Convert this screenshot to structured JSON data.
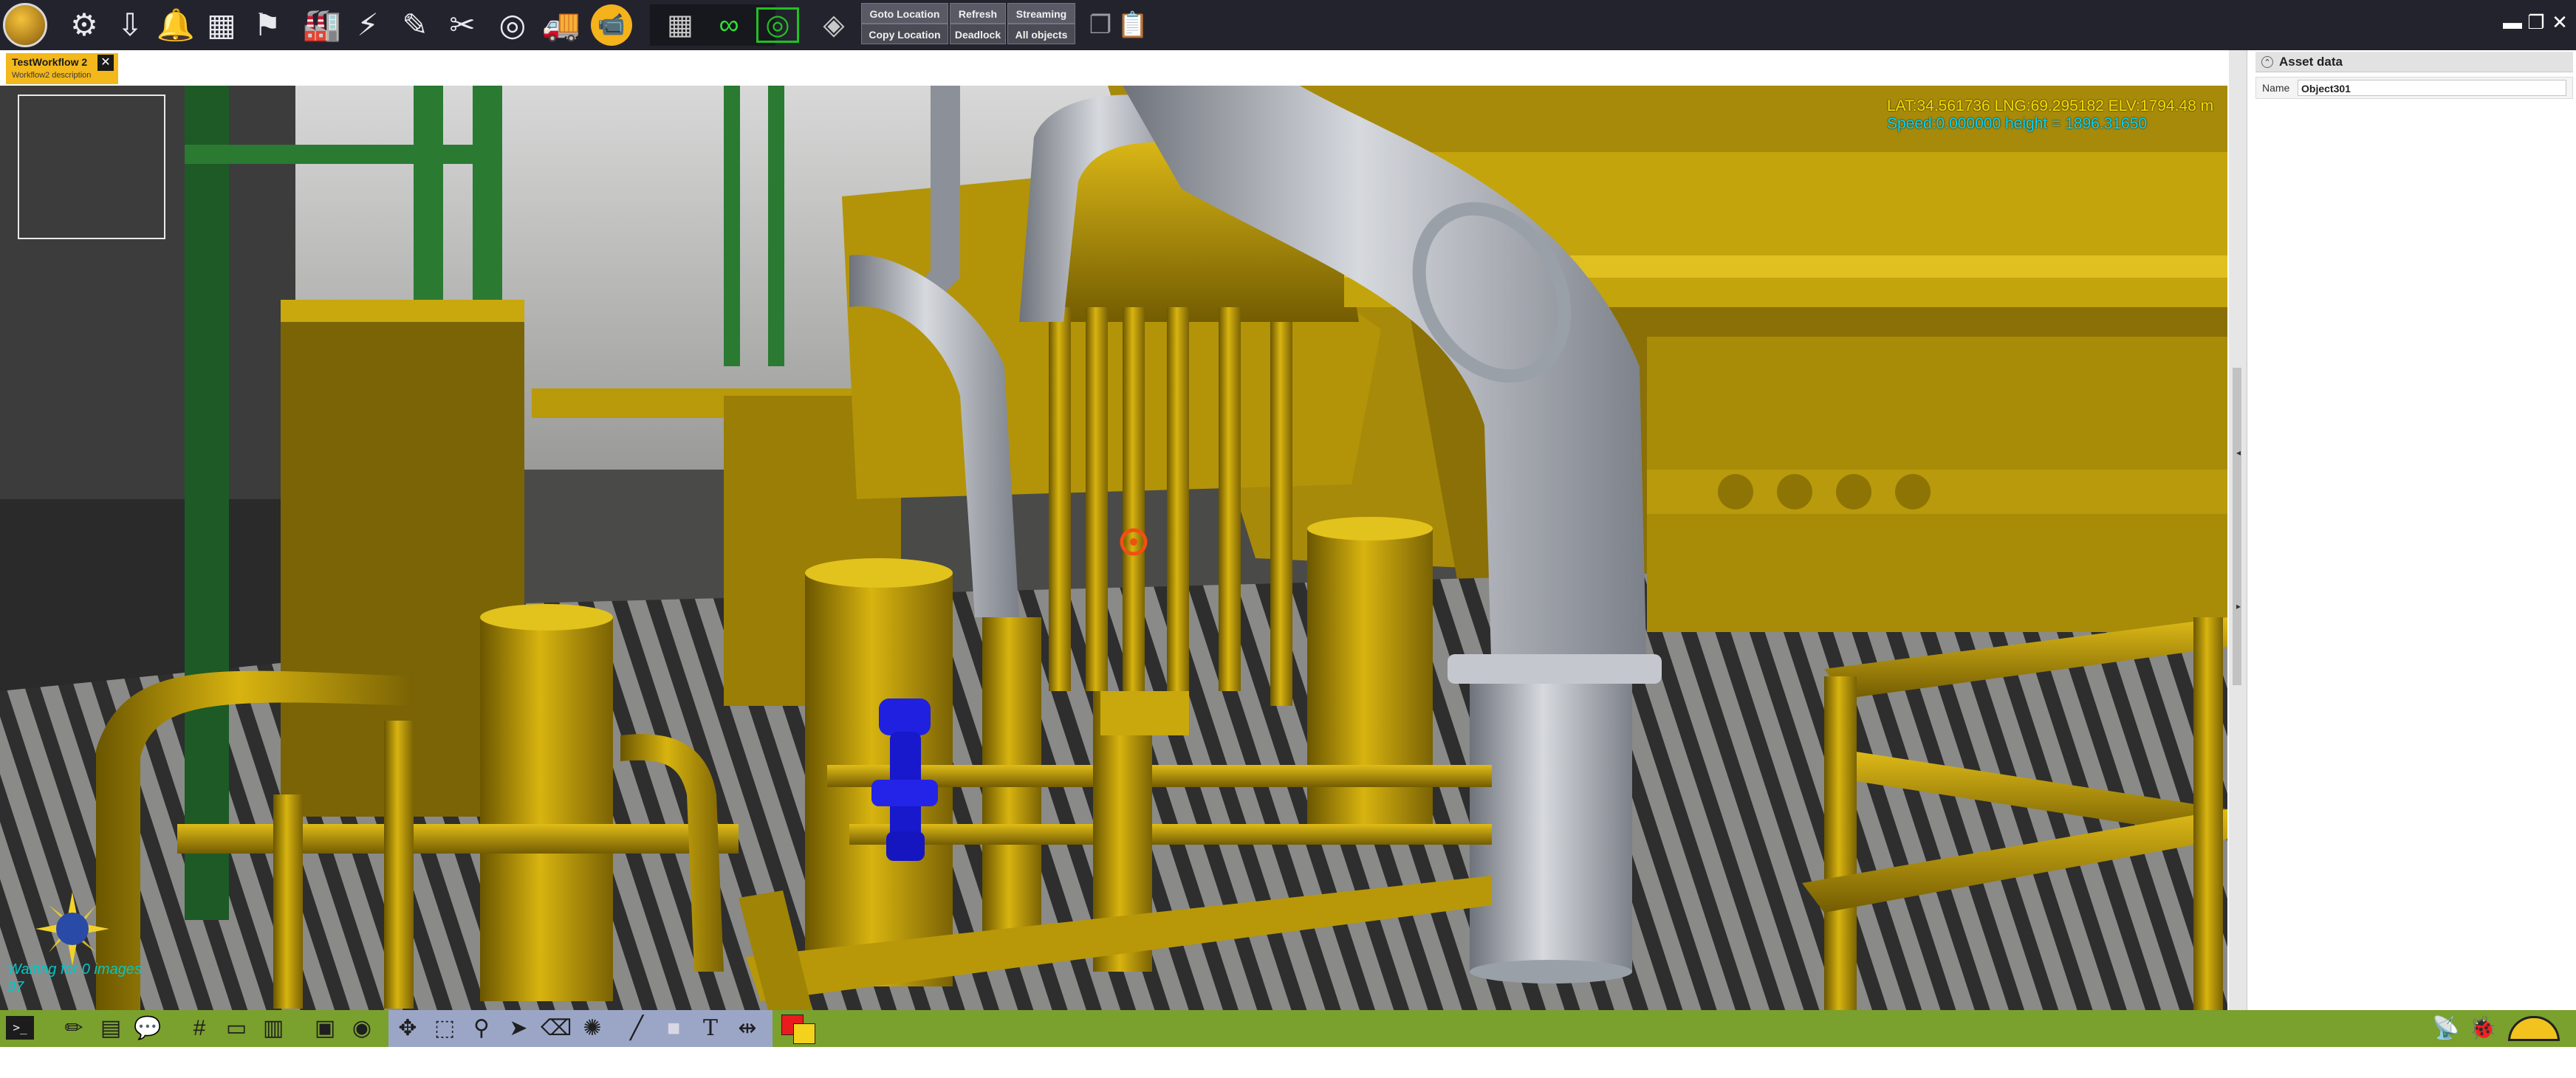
{
  "toolbar": {
    "tools": [
      {
        "name": "robot-tools-icon",
        "glyph": "⚙"
      },
      {
        "name": "download-icon",
        "glyph": "⇩"
      },
      {
        "name": "bell-icon",
        "glyph": "🔔"
      },
      {
        "name": "control-panel-icon",
        "glyph": "▦"
      },
      {
        "name": "surveyor-icon",
        "glyph": "⚑"
      },
      {
        "name": "building-icon",
        "glyph": "🏭"
      },
      {
        "name": "tower-icon",
        "glyph": "⚡"
      },
      {
        "name": "pen-icon",
        "glyph": "✎"
      },
      {
        "name": "wrench-cross-icon",
        "glyph": "✂"
      },
      {
        "name": "target-icon",
        "glyph": "◎"
      },
      {
        "name": "truck-icon",
        "glyph": "🚚"
      },
      {
        "name": "camera-icon",
        "glyph": "📹"
      }
    ],
    "view_tools": [
      {
        "name": "grid-view-icon",
        "glyph": "▦"
      },
      {
        "name": "vr-goggles-icon",
        "glyph": "∞"
      },
      {
        "name": "stereo-box-icon",
        "glyph": "◎"
      },
      {
        "name": "cube-icon",
        "glyph": "◈"
      }
    ],
    "buttons": {
      "goto_location": "Goto Location",
      "refresh": "Refresh",
      "streaming": "Streaming",
      "copy_location": "Copy Location",
      "deadlock": "Deadlock",
      "all_objects": "All objects"
    },
    "clipboard": [
      {
        "name": "copy-icon",
        "glyph": "❐"
      },
      {
        "name": "paste-icon",
        "glyph": "📋"
      }
    ],
    "window": {
      "minimize": "▬",
      "restore": "❐",
      "close": "✕"
    }
  },
  "tab": {
    "title": "TestWorkflow 2",
    "description": "Workflow2 description",
    "close": "✕"
  },
  "viewport": {
    "coordinates": "LAT:34.561736 LNG:69.295182 ELV:1794.48 m",
    "speed": "Speed:0.000000 height = 1896.31650",
    "waiting": "Waiting for 0 images",
    "count": "97",
    "colors": {
      "yellow_pipe": "#c8a208",
      "grey_pipe": "#b8bcc4",
      "green_frame": "#1f6e2a",
      "blue_valve": "#1818d8"
    }
  },
  "asset_panel": {
    "title": "Asset data",
    "toggle": "⌃",
    "name_label": "Name",
    "name_value": "Object301",
    "scroll_up": "◂",
    "scroll_down": "▸"
  },
  "bottombar": {
    "left_tools": [
      {
        "name": "pencil-icon",
        "glyph": "✏"
      },
      {
        "name": "layers-icon",
        "glyph": "▤"
      },
      {
        "name": "comment-icon",
        "glyph": "💬"
      },
      {
        "name": "grid-icon",
        "glyph": "#"
      },
      {
        "name": "frame-icon",
        "glyph": "▭"
      },
      {
        "name": "hatch-icon",
        "glyph": "▥"
      },
      {
        "name": "image-icon",
        "glyph": "▣"
      },
      {
        "name": "orbit-icon",
        "glyph": "◉"
      }
    ],
    "mid_tools": [
      {
        "name": "move-icon",
        "glyph": "✥"
      },
      {
        "name": "select-box-icon",
        "glyph": "⬚"
      },
      {
        "name": "stamp-icon",
        "glyph": "⚲"
      },
      {
        "name": "pointer-icon",
        "glyph": "➤"
      },
      {
        "name": "eraser-icon",
        "glyph": "⌫"
      },
      {
        "name": "aperture-icon",
        "glyph": "✺"
      },
      {
        "name": "line-icon",
        "glyph": "╱"
      },
      {
        "name": "rectangle-icon",
        "glyph": "■"
      },
      {
        "name": "text-icon",
        "glyph": "T"
      },
      {
        "name": "measure-icon",
        "glyph": "⇹"
      }
    ],
    "terminal": ">_",
    "right_tools": [
      {
        "name": "wireless-icon",
        "glyph": "📡"
      },
      {
        "name": "bug-icon",
        "glyph": "🐞"
      }
    ],
    "gauge": "speed-gauge-icon"
  }
}
